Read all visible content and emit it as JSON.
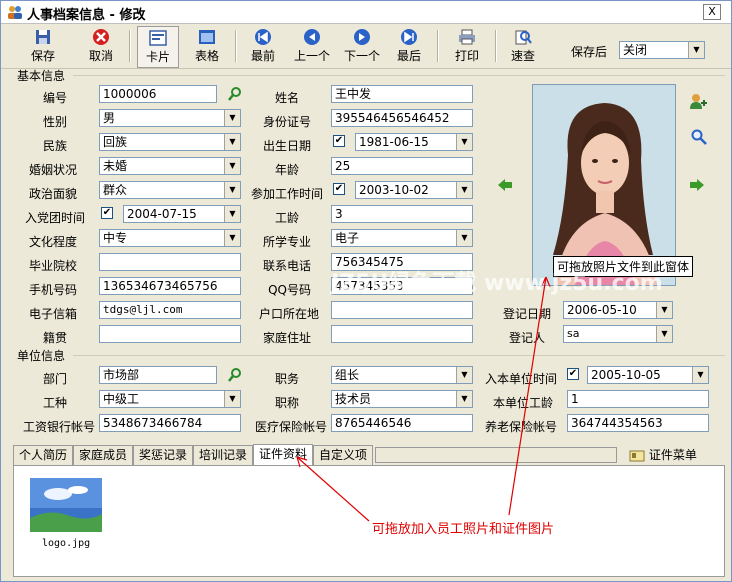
{
  "window": {
    "title": "人事档案信息 - 修改",
    "close_label": "X"
  },
  "toolbar": {
    "save": "保存",
    "cancel": "取消",
    "card": "卡片",
    "table": "表格",
    "first": "最前",
    "prev": "上一个",
    "next": "下一个",
    "last": "最后",
    "print": "打印",
    "search": "速查",
    "after_save_label": "保存后",
    "after_save_value": "关闭"
  },
  "basic": {
    "section_title": "基本信息",
    "id_label": "编号",
    "id_value": "1000006",
    "name_label": "姓名",
    "name_value": "王中发",
    "gender_label": "性别",
    "gender_value": "男",
    "idcard_label": "身份证号",
    "idcard_value": "395546456546452",
    "ethnicity_label": "民族",
    "ethnicity_value": "回族",
    "birth_label": "出生日期",
    "birth_value": "1981-06-15",
    "marital_label": "婚姻状况",
    "marital_value": "未婚",
    "age_label": "年龄",
    "age_value": "25",
    "political_label": "政治面貌",
    "political_value": "群众",
    "workstart_label": "参加工作时间",
    "workstart_value": "2003-10-02",
    "party_label": "入党团时间",
    "party_value": "2004-07-15",
    "seniority_label": "工龄",
    "seniority_value": "3",
    "education_label": "文化程度",
    "education_value": "中专",
    "major_label": "所学专业",
    "major_value": "电子",
    "school_label": "毕业院校",
    "school_value": "",
    "phone_label": "联系电话",
    "phone_value": "756345475",
    "mobile_label": "手机号码",
    "mobile_value": "136534673465756",
    "qq_label": "QQ号码",
    "qq_value": "457345353",
    "email_label": "电子信箱",
    "email_value": "tdgs@ljl.com",
    "hukou_label": "户口所在地",
    "hukou_value": "",
    "regdate_label": "登记日期",
    "regdate_value": "2006-05-10",
    "origin_label": "籍贯",
    "origin_value": "",
    "address_label": "家庭住址",
    "address_value": "",
    "registrar_label": "登记人",
    "registrar_value": "sa",
    "photo_caption": "可拖放照片文件到此窗体"
  },
  "unit": {
    "section_title": "单位信息",
    "dept_label": "部门",
    "dept_value": "市场部",
    "position_label": "职务",
    "position_value": "组长",
    "join_label": "入本单位时间",
    "join_value": "2005-10-05",
    "worktype_label": "工种",
    "worktype_value": "中级工",
    "title_label": "职称",
    "title_value": "技术员",
    "unit_seniority_label": "本单位工龄",
    "unit_seniority_value": "1",
    "bank_label": "工资银行帐号",
    "bank_value": "5348673466784",
    "medical_label": "医疗保险帐号",
    "medical_value": "8765446546",
    "pension_label": "养老保险帐号",
    "pension_value": "364744354563"
  },
  "tabs": [
    "个人简历",
    "家庭成员",
    "奖惩记录",
    "培训记录",
    "证件资料",
    "自定义项"
  ],
  "tab_menu": "证件菜单",
  "attachment": {
    "filename": "logo.jpg"
  },
  "annotation": "可拖放加入员工照片和证件图片",
  "watermark": "JZ5U绿色下载 www.jz5u.com",
  "colors": {
    "accent_red": "#e00000",
    "field_border": "#7f9db9",
    "window_bg": "#ece9d8"
  }
}
